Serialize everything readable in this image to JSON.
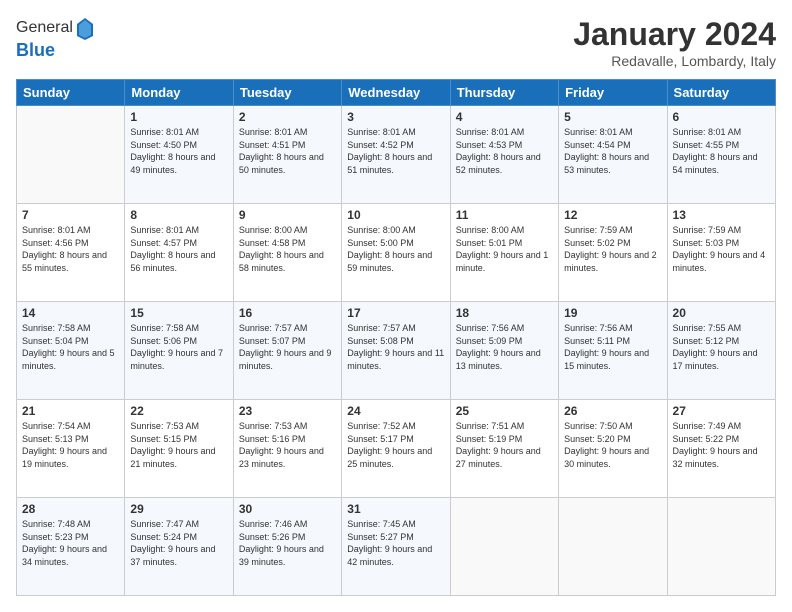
{
  "logo": {
    "general": "General",
    "blue": "Blue"
  },
  "title": "January 2024",
  "subtitle": "Redavalle, Lombardy, Italy",
  "days_header": [
    "Sunday",
    "Monday",
    "Tuesday",
    "Wednesday",
    "Thursday",
    "Friday",
    "Saturday"
  ],
  "weeks": [
    [
      {
        "day": "",
        "sunrise": "",
        "sunset": "",
        "daylight": ""
      },
      {
        "day": "1",
        "sunrise": "Sunrise: 8:01 AM",
        "sunset": "Sunset: 4:50 PM",
        "daylight": "Daylight: 8 hours and 49 minutes."
      },
      {
        "day": "2",
        "sunrise": "Sunrise: 8:01 AM",
        "sunset": "Sunset: 4:51 PM",
        "daylight": "Daylight: 8 hours and 50 minutes."
      },
      {
        "day": "3",
        "sunrise": "Sunrise: 8:01 AM",
        "sunset": "Sunset: 4:52 PM",
        "daylight": "Daylight: 8 hours and 51 minutes."
      },
      {
        "day": "4",
        "sunrise": "Sunrise: 8:01 AM",
        "sunset": "Sunset: 4:53 PM",
        "daylight": "Daylight: 8 hours and 52 minutes."
      },
      {
        "day": "5",
        "sunrise": "Sunrise: 8:01 AM",
        "sunset": "Sunset: 4:54 PM",
        "daylight": "Daylight: 8 hours and 53 minutes."
      },
      {
        "day": "6",
        "sunrise": "Sunrise: 8:01 AM",
        "sunset": "Sunset: 4:55 PM",
        "daylight": "Daylight: 8 hours and 54 minutes."
      }
    ],
    [
      {
        "day": "7",
        "sunrise": "Sunrise: 8:01 AM",
        "sunset": "Sunset: 4:56 PM",
        "daylight": "Daylight: 8 hours and 55 minutes."
      },
      {
        "day": "8",
        "sunrise": "Sunrise: 8:01 AM",
        "sunset": "Sunset: 4:57 PM",
        "daylight": "Daylight: 8 hours and 56 minutes."
      },
      {
        "day": "9",
        "sunrise": "Sunrise: 8:00 AM",
        "sunset": "Sunset: 4:58 PM",
        "daylight": "Daylight: 8 hours and 58 minutes."
      },
      {
        "day": "10",
        "sunrise": "Sunrise: 8:00 AM",
        "sunset": "Sunset: 5:00 PM",
        "daylight": "Daylight: 8 hours and 59 minutes."
      },
      {
        "day": "11",
        "sunrise": "Sunrise: 8:00 AM",
        "sunset": "Sunset: 5:01 PM",
        "daylight": "Daylight: 9 hours and 1 minute."
      },
      {
        "day": "12",
        "sunrise": "Sunrise: 7:59 AM",
        "sunset": "Sunset: 5:02 PM",
        "daylight": "Daylight: 9 hours and 2 minutes."
      },
      {
        "day": "13",
        "sunrise": "Sunrise: 7:59 AM",
        "sunset": "Sunset: 5:03 PM",
        "daylight": "Daylight: 9 hours and 4 minutes."
      }
    ],
    [
      {
        "day": "14",
        "sunrise": "Sunrise: 7:58 AM",
        "sunset": "Sunset: 5:04 PM",
        "daylight": "Daylight: 9 hours and 5 minutes."
      },
      {
        "day": "15",
        "sunrise": "Sunrise: 7:58 AM",
        "sunset": "Sunset: 5:06 PM",
        "daylight": "Daylight: 9 hours and 7 minutes."
      },
      {
        "day": "16",
        "sunrise": "Sunrise: 7:57 AM",
        "sunset": "Sunset: 5:07 PM",
        "daylight": "Daylight: 9 hours and 9 minutes."
      },
      {
        "day": "17",
        "sunrise": "Sunrise: 7:57 AM",
        "sunset": "Sunset: 5:08 PM",
        "daylight": "Daylight: 9 hours and 11 minutes."
      },
      {
        "day": "18",
        "sunrise": "Sunrise: 7:56 AM",
        "sunset": "Sunset: 5:09 PM",
        "daylight": "Daylight: 9 hours and 13 minutes."
      },
      {
        "day": "19",
        "sunrise": "Sunrise: 7:56 AM",
        "sunset": "Sunset: 5:11 PM",
        "daylight": "Daylight: 9 hours and 15 minutes."
      },
      {
        "day": "20",
        "sunrise": "Sunrise: 7:55 AM",
        "sunset": "Sunset: 5:12 PM",
        "daylight": "Daylight: 9 hours and 17 minutes."
      }
    ],
    [
      {
        "day": "21",
        "sunrise": "Sunrise: 7:54 AM",
        "sunset": "Sunset: 5:13 PM",
        "daylight": "Daylight: 9 hours and 19 minutes."
      },
      {
        "day": "22",
        "sunrise": "Sunrise: 7:53 AM",
        "sunset": "Sunset: 5:15 PM",
        "daylight": "Daylight: 9 hours and 21 minutes."
      },
      {
        "day": "23",
        "sunrise": "Sunrise: 7:53 AM",
        "sunset": "Sunset: 5:16 PM",
        "daylight": "Daylight: 9 hours and 23 minutes."
      },
      {
        "day": "24",
        "sunrise": "Sunrise: 7:52 AM",
        "sunset": "Sunset: 5:17 PM",
        "daylight": "Daylight: 9 hours and 25 minutes."
      },
      {
        "day": "25",
        "sunrise": "Sunrise: 7:51 AM",
        "sunset": "Sunset: 5:19 PM",
        "daylight": "Daylight: 9 hours and 27 minutes."
      },
      {
        "day": "26",
        "sunrise": "Sunrise: 7:50 AM",
        "sunset": "Sunset: 5:20 PM",
        "daylight": "Daylight: 9 hours and 30 minutes."
      },
      {
        "day": "27",
        "sunrise": "Sunrise: 7:49 AM",
        "sunset": "Sunset: 5:22 PM",
        "daylight": "Daylight: 9 hours and 32 minutes."
      }
    ],
    [
      {
        "day": "28",
        "sunrise": "Sunrise: 7:48 AM",
        "sunset": "Sunset: 5:23 PM",
        "daylight": "Daylight: 9 hours and 34 minutes."
      },
      {
        "day": "29",
        "sunrise": "Sunrise: 7:47 AM",
        "sunset": "Sunset: 5:24 PM",
        "daylight": "Daylight: 9 hours and 37 minutes."
      },
      {
        "day": "30",
        "sunrise": "Sunrise: 7:46 AM",
        "sunset": "Sunset: 5:26 PM",
        "daylight": "Daylight: 9 hours and 39 minutes."
      },
      {
        "day": "31",
        "sunrise": "Sunrise: 7:45 AM",
        "sunset": "Sunset: 5:27 PM",
        "daylight": "Daylight: 9 hours and 42 minutes."
      },
      {
        "day": "",
        "sunrise": "",
        "sunset": "",
        "daylight": ""
      },
      {
        "day": "",
        "sunrise": "",
        "sunset": "",
        "daylight": ""
      },
      {
        "day": "",
        "sunrise": "",
        "sunset": "",
        "daylight": ""
      }
    ]
  ]
}
